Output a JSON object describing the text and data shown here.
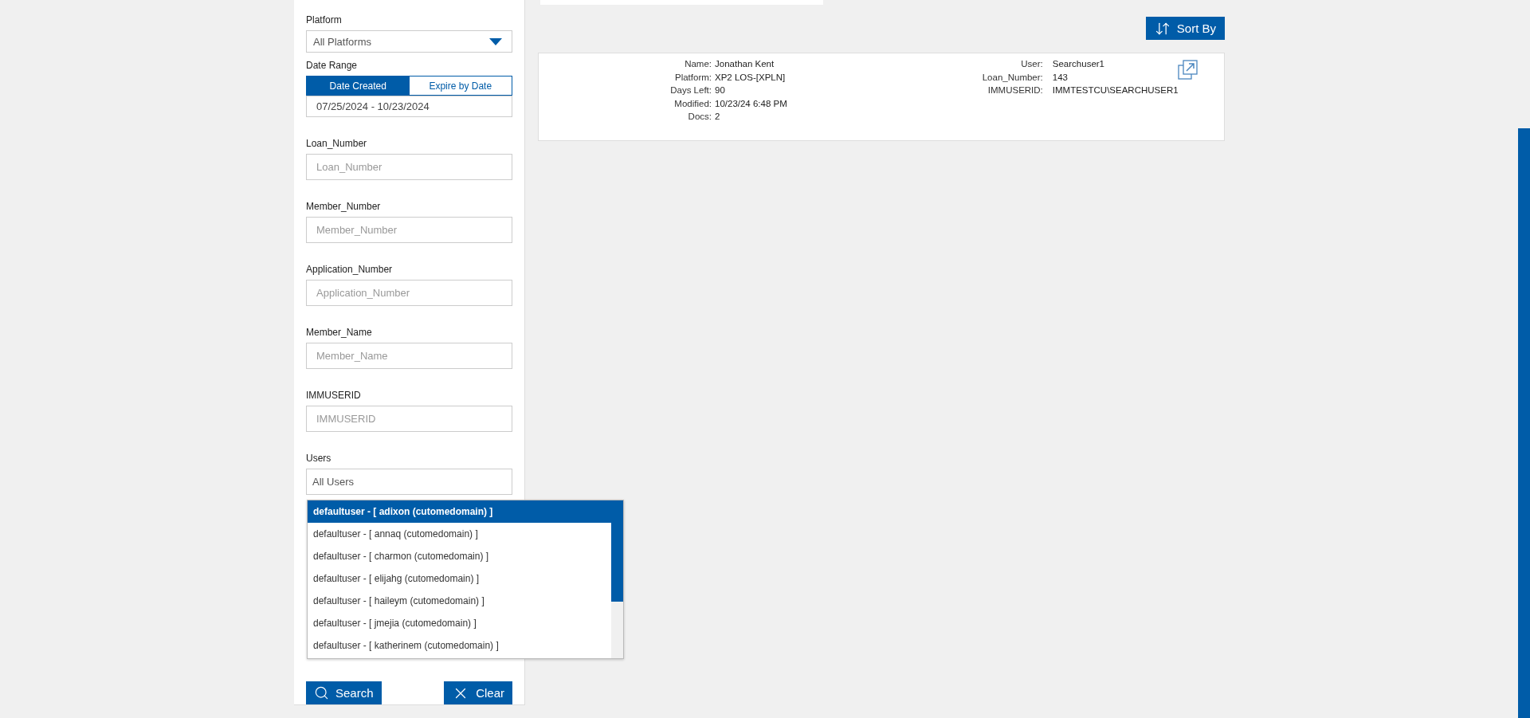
{
  "filters": {
    "platform": {
      "label": "Platform",
      "value": "All Platforms"
    },
    "date_range": {
      "label": "Date Range",
      "tabs": [
        {
          "label": "Date Created",
          "selected": true
        },
        {
          "label": "Expire by Date",
          "selected": false
        }
      ],
      "value": "07/25/2024 - 10/23/2024"
    },
    "fields": [
      {
        "label": "Loan_Number",
        "placeholder": "Loan_Number"
      },
      {
        "label": "Member_Number",
        "placeholder": "Member_Number"
      },
      {
        "label": "Application_Number",
        "placeholder": "Application_Number"
      },
      {
        "label": "Member_Name",
        "placeholder": "Member_Name"
      },
      {
        "label": "IMMUSERID",
        "placeholder": "IMMUSERID"
      }
    ],
    "users": {
      "label": "Users",
      "value": "All Users",
      "options": [
        {
          "label": "defaultuser - [ adixon (cutomedomain) ]",
          "selected": true
        },
        {
          "label": "defaultuser - [ annaq (cutomedomain) ]",
          "selected": false
        },
        {
          "label": "defaultuser - [ charmon (cutomedomain) ]",
          "selected": false
        },
        {
          "label": "defaultuser - [ elijahg (cutomedomain) ]",
          "selected": false
        },
        {
          "label": "defaultuser - [ haileym (cutomedomain) ]",
          "selected": false
        },
        {
          "label": "defaultuser - [ jmejia (cutomedomain) ]",
          "selected": false
        },
        {
          "label": "defaultuser - [ katherinem (cutomedomain) ]",
          "selected": false
        }
      ]
    },
    "buttons": [
      {
        "kind": "search",
        "label": "Search"
      },
      {
        "kind": "clear",
        "label": "Clear"
      }
    ]
  },
  "sort_button": "Sort By",
  "results": [
    {
      "left": [
        {
          "label": "Name:",
          "value": "Jonathan Kent"
        },
        {
          "label": "Platform:",
          "value": "XP2 LOS-[XPLN]"
        },
        {
          "label": "Days Left:",
          "value": "90"
        },
        {
          "label": "Modified:",
          "value": "10/23/24 6:48 PM"
        },
        {
          "label": "Docs:",
          "value": "2"
        }
      ],
      "right": [
        {
          "label": "User:",
          "value": "Searchuser1"
        },
        {
          "label": "Loan_Number:",
          "value": "143"
        },
        {
          "label": "IMMUSERID:",
          "value": "IMMTESTCU\\SEARCHUSER1"
        }
      ]
    }
  ]
}
